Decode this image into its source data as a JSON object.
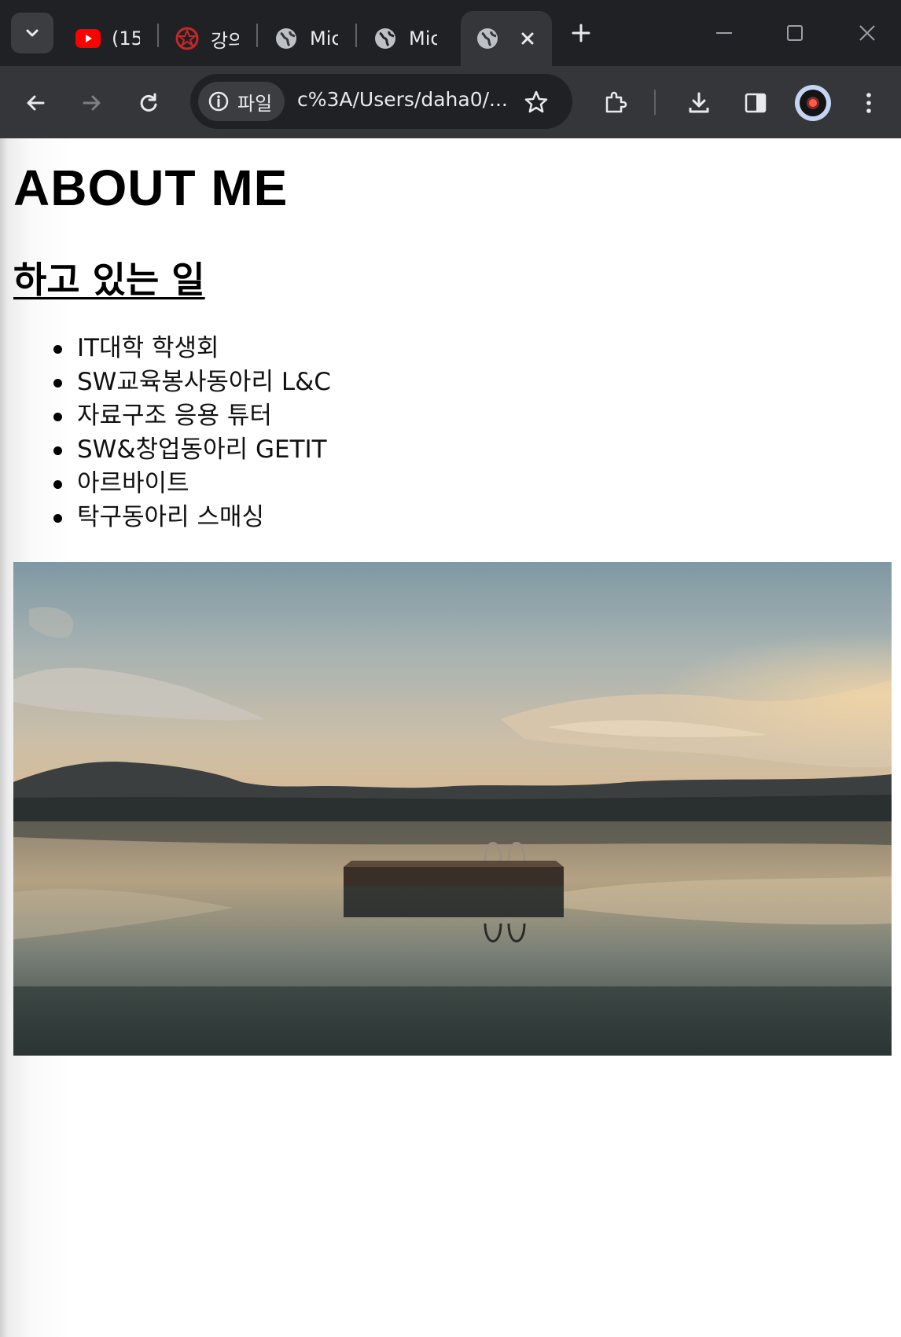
{
  "browser": {
    "tabs": [
      {
        "title": "(15",
        "icon": "youtube-icon"
      },
      {
        "title": "강의",
        "icon": "university-emblem-icon"
      },
      {
        "title": "Mic",
        "icon": "globe-icon"
      },
      {
        "title": "Mic",
        "icon": "globe-icon"
      },
      {
        "title": "",
        "icon": "globe-icon",
        "active": true
      }
    ],
    "site_chip": "파일",
    "url": "c%3A/Users/daha0/...",
    "colors": {
      "frame": "#202124",
      "toolbar": "#35363a",
      "text": "#e8eaed"
    }
  },
  "page": {
    "title": "ABOUT ME",
    "section_heading": "하고 있는 일",
    "activities": [
      "IT대학 학생회",
      "SW교육봉사동아리 L&C",
      "자료구조 응용 튜터",
      "SW&창업동아리 GETIT",
      "아르바이트",
      "탁구동아리 스매싱"
    ],
    "image": {
      "icon": "lake-dock-sunset-photo"
    }
  }
}
